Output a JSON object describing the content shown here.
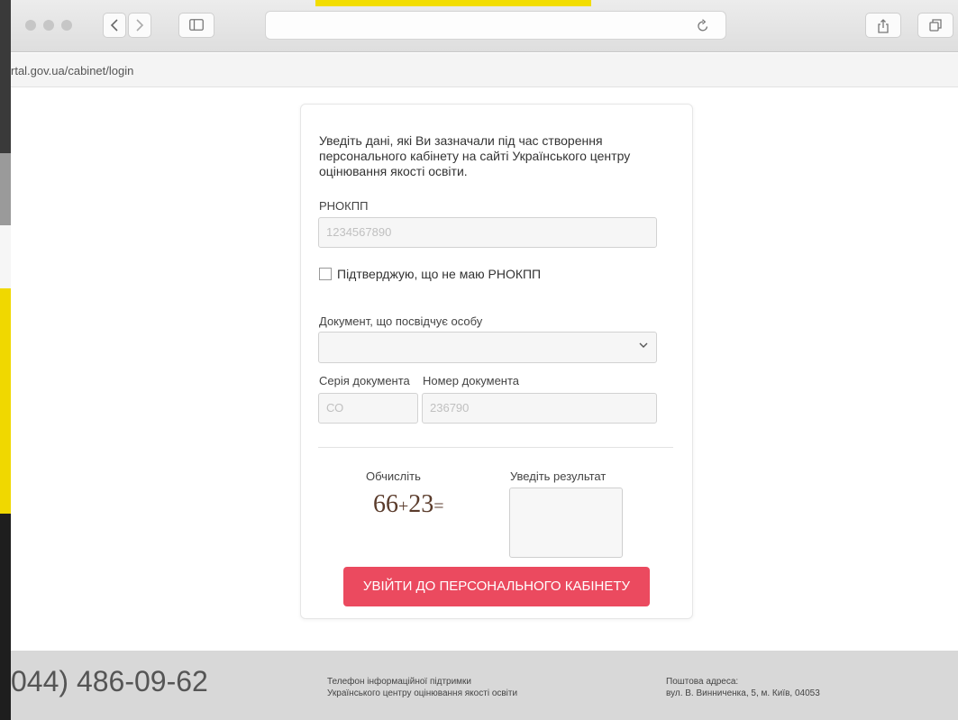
{
  "browser": {
    "url": "rtal.gov.ua/cabinet/login"
  },
  "form": {
    "intro": "Уведіть дані, які Ви зазначали під час створення персонального кабінету на сайті Українського центру оцінювання якості освіти.",
    "rnokpp_label": "РНОКПП",
    "rnokpp_placeholder": "1234567890",
    "no_rnokpp_label": "Підтверджую, що не маю РНОКПП",
    "document_label": "Документ, що посвідчує особу",
    "doc_series_label": "Серія документа",
    "doc_number_label": "Номер документа",
    "doc_series_placeholder": "СО",
    "doc_number_placeholder": "236790",
    "captcha_label": "Обчисліть",
    "captcha_a": "66",
    "captcha_op": "+",
    "captcha_b": "23",
    "captcha_eq": "=",
    "result_label": "Уведіть результат",
    "submit_label": "УВІЙТИ ДО ПЕРСОНАЛЬНОГО КАБІНЕТУ"
  },
  "footer": {
    "phone": "044) 486-09-62",
    "support_line1": "Телефон інформаційної підтримки",
    "support_line2": "Українського центру оцінювання якості освіти",
    "address_line1": "Поштова адреса:",
    "address_line2": "вул. В. Винниченка, 5, м. Київ, 04053"
  },
  "colors": {
    "accent_button": "#eb4a5f",
    "yellow": "#f2dd00"
  }
}
